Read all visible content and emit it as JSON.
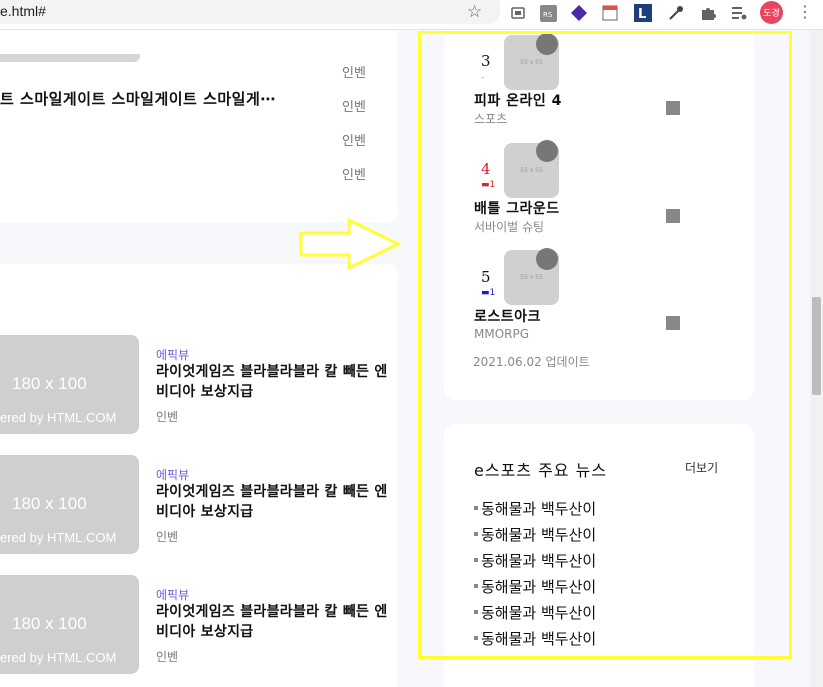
{
  "browser": {
    "url": "e.html#",
    "profile_initials": "도경",
    "icons": [
      "star-icon",
      "cast-icon",
      "rss-icon",
      "diamond-icon",
      "calendar-icon",
      "reader-icon",
      "eyedropper-icon",
      "puzzle-icon",
      "media-icon",
      "more-icon"
    ]
  },
  "left": {
    "headline": "트 스마일게이트 스마일게이트 스마일게⋯",
    "sources": [
      "인벤",
      "인벤",
      "인벤",
      "인벤"
    ],
    "news": [
      {
        "category": "에픽뷰",
        "title": "라이엇게임즈 블라블라블라 칼 빼든 엔비디아 보상지급",
        "source": "인벤",
        "thumb": "180 x 100",
        "thumb_credit": "ered by HTML.COM"
      },
      {
        "category": "에픽뷰",
        "title": "라이엇게임즈 블라블라블라 칼 빼든 엔비디아 보상지급",
        "source": "인벤",
        "thumb": "180 x 100",
        "thumb_credit": "ered by HTML.COM"
      },
      {
        "category": "에픽뷰",
        "title": "라이엇게임즈 블라블라블라 칼 빼든 엔비디아 보상지급",
        "source": "인벤",
        "thumb": "180 x 100",
        "thumb_credit": "ered by HTML.COM"
      }
    ]
  },
  "ranking": {
    "games": [
      {
        "rank": "3",
        "change": "-",
        "name": "피파 온라인 4",
        "genre": "스포츠",
        "img_label": "55 x 55",
        "rank_color": "#111111",
        "change_color": "#999999"
      },
      {
        "rank": "4",
        "change": "▬1",
        "name": "배틀 그라운드",
        "genre": "서바이벌 슈팅",
        "img_label": "55 x 55",
        "rank_color": "#e0202a",
        "change_color": "#e0202a"
      },
      {
        "rank": "5",
        "change": "▬1",
        "name": "로스트아크",
        "genre": "MMORPG",
        "img_label": "55 x 55",
        "rank_color": "#111111",
        "change_color": "#1a1ad6"
      }
    ],
    "update": "2021.06.02 업데이트"
  },
  "esports": {
    "title": "e스포츠 주요 뉴스",
    "more": "더보기",
    "items": [
      "동해물과 백두산이",
      "동해물과 백두산이",
      "동해물과 백두산이",
      "동해물과 백두산이",
      "동해물과 백두산이",
      "동해물과 백두산이"
    ]
  },
  "colors": {
    "highlight": "#ffff33",
    "category": "#6b63d9",
    "up": "#e0202a",
    "down": "#1a1ad6"
  }
}
